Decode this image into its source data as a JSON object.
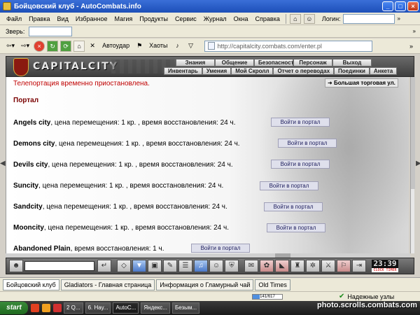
{
  "window": {
    "title": "Бойцовский клуб - AutoCombats.info"
  },
  "menu": {
    "items": [
      "Файл",
      "Правка",
      "Вид",
      "Избранное",
      "Магия",
      "Продукты",
      "Сервис",
      "Журнал",
      "Окна",
      "Справка"
    ],
    "login_label": "Логин:"
  },
  "beast": {
    "label": "Зверь:"
  },
  "toolbar": {
    "autoudar": "Автоудар",
    "chaos": "Хаоты",
    "address": "http://capitalcity.combats.com/enter.pl"
  },
  "game": {
    "logo": "CAPITALCITY",
    "nav_top": [
      "Знания",
      "Общение",
      "Безопасность",
      "Персонаж",
      "Выход"
    ],
    "nav_bottom": [
      "Инвентарь",
      "Умения",
      "Мой Скролл",
      "Отчет о переводах",
      "Поединки",
      "Анкета"
    ],
    "teleport_message": "Телепортация временно приостановлена.",
    "market_button": "Большая торговая ул.",
    "portal_title": "Портал",
    "portal_button": "Войти в портал",
    "cities": [
      {
        "name": "Angels city",
        "text": ", цена перемещения: 1 кр. , время восстановления: 24 ч."
      },
      {
        "name": "Demons city",
        "text": ", цена перемещения: 1 кр. , время восстановления: 24 ч."
      },
      {
        "name": "Devils city",
        "text": ", цена перемещения: 1 кр. , время восстановления: 24 ч."
      },
      {
        "name": "Suncity",
        "text": ", цена перемещения: 1 кр. , время восстановления: 24 ч."
      },
      {
        "name": "Sandcity",
        "text": ", цена перемещения: 1 кр. , время восстановления: 24 ч."
      },
      {
        "name": "Mooncity",
        "text": ", цена перемещения: 1 кр. , время восстановления: 24 ч."
      },
      {
        "name": "Abandoned Plain",
        "text": ", время восстановления: 1 ч."
      }
    ],
    "clock": "23:39",
    "clock_label": "CLOCK TIMER"
  },
  "tabs": [
    "Бойцовский клуб",
    "Gladiators - Главная страница",
    "Информация о Гламурный чай",
    "Old Times"
  ],
  "status": {
    "progress_text": "141/617",
    "progress_fraction": 0.23,
    "secure_label": "Надежные узлы"
  },
  "taskbar": {
    "start": "start",
    "tasks": [
      "2 Q...",
      "6. Нау...",
      "AutoC...",
      "Яндекс...",
      "Безым..."
    ]
  },
  "watermark": "photo.scrolls.combats.com",
  "colors": {
    "title_blue": "#1d4fb8",
    "teleport_red": "#c00000",
    "portal_title": "#7a0000"
  }
}
